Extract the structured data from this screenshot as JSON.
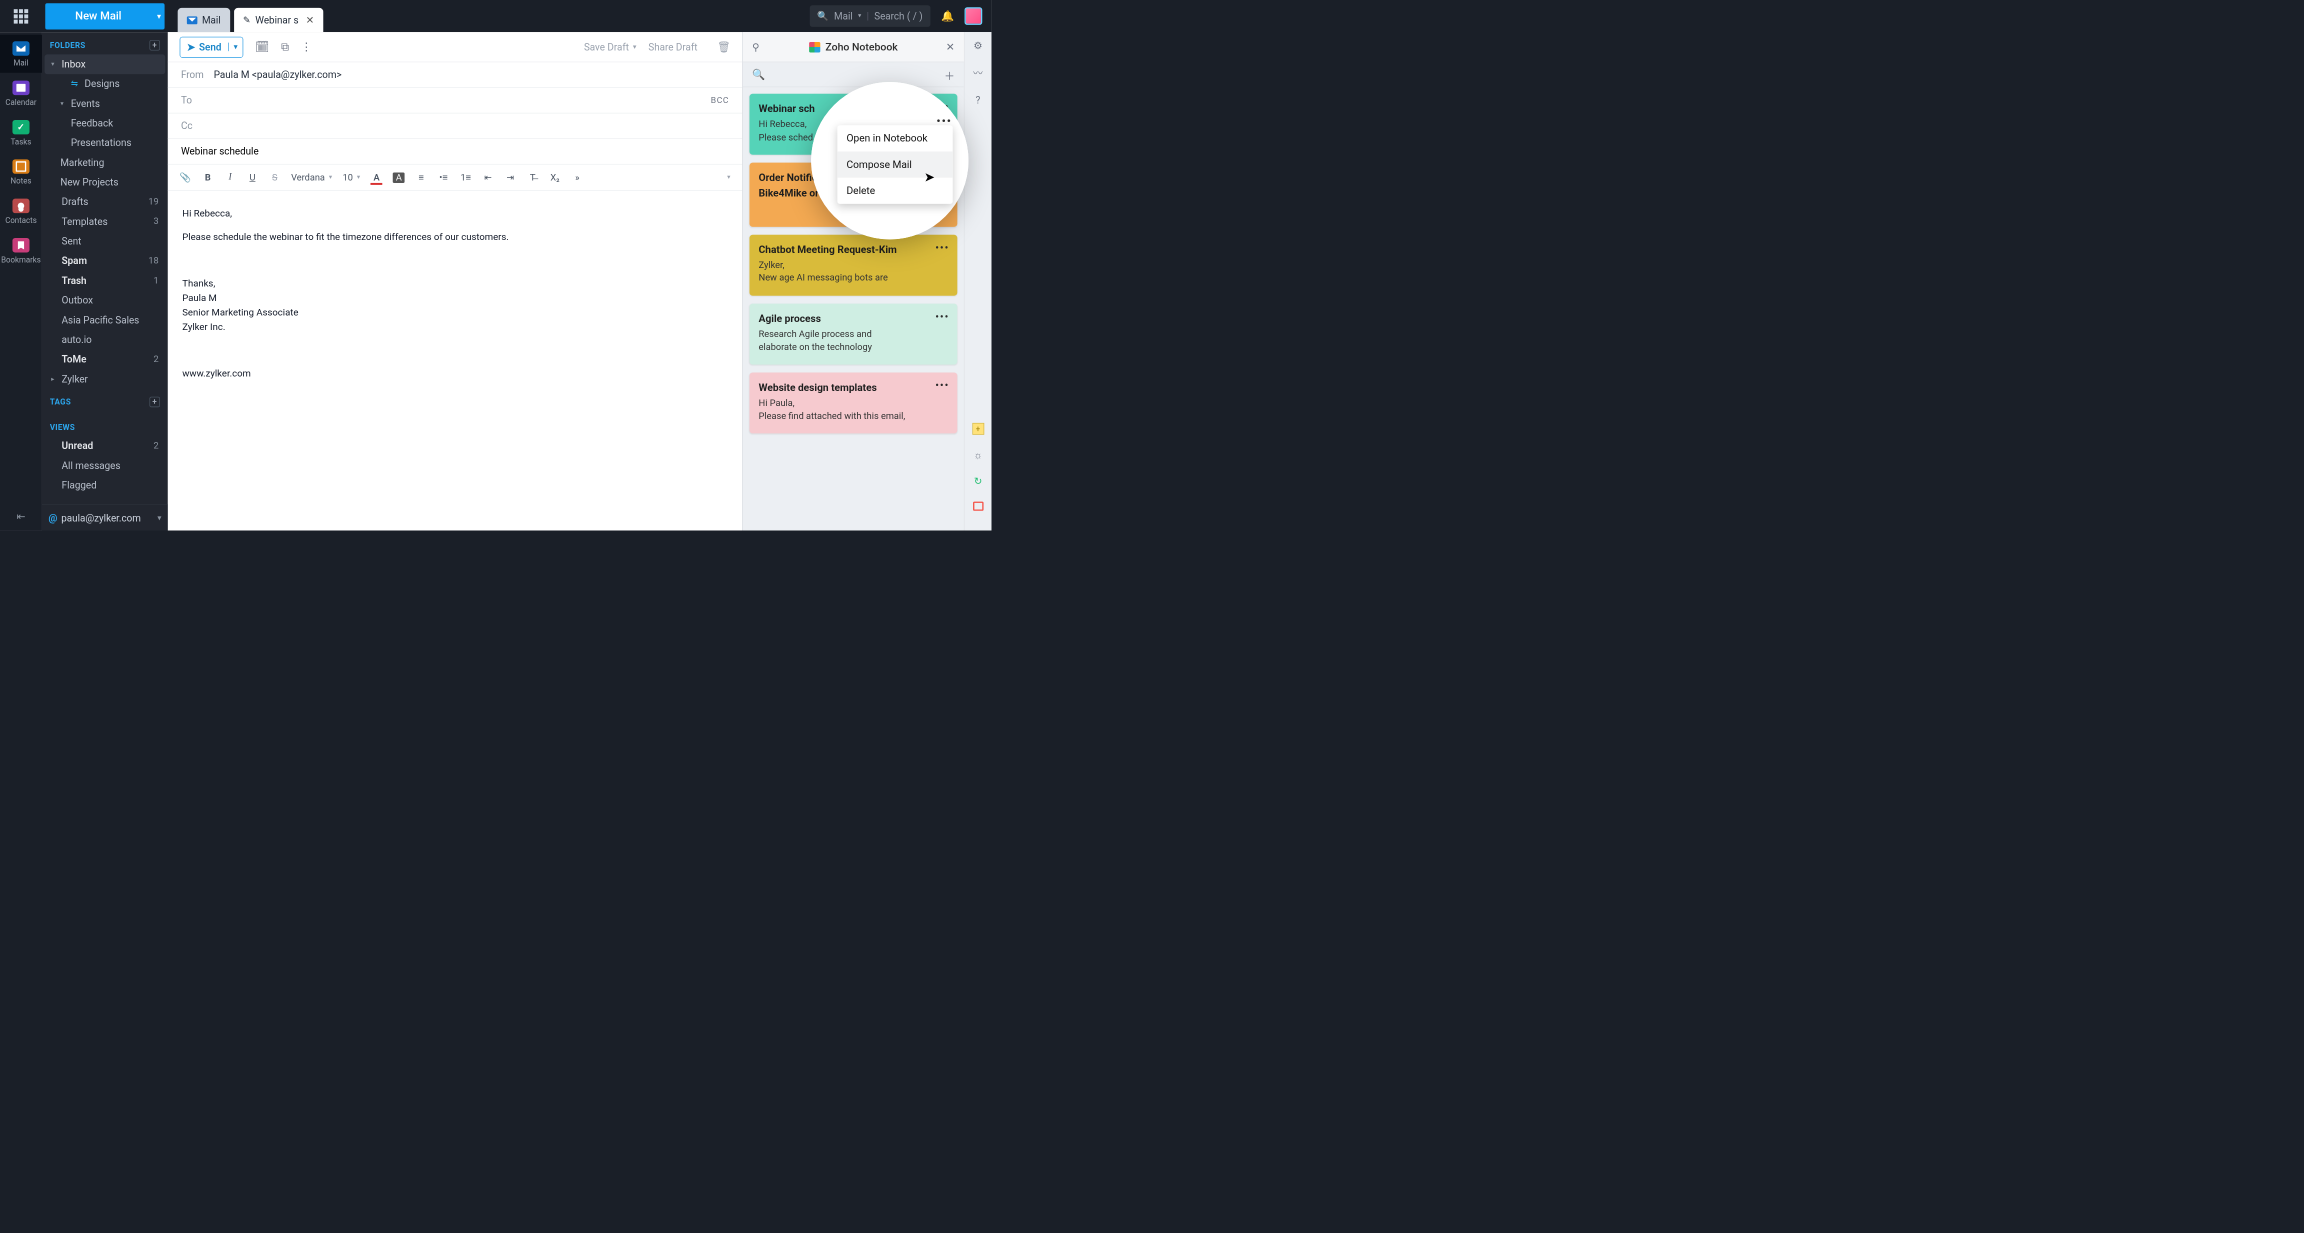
{
  "topbar": {
    "newMail": "New Mail",
    "tabMail": "Mail",
    "tabActive": "Webinar s",
    "searchScope": "Mail",
    "searchPlaceholder": "Search ( / )"
  },
  "rail": {
    "items": [
      "Mail",
      "Calendar",
      "Tasks",
      "Notes",
      "Contacts",
      "Bookmarks"
    ]
  },
  "sidebar": {
    "foldersLabel": "FOLDERS",
    "inbox": "Inbox",
    "designs": "Designs",
    "events": "Events",
    "feedback": "Feedback",
    "presentations": "Presentations",
    "marketing": "Marketing",
    "newProjects": "New Projects",
    "drafts": "Drafts",
    "draftsCount": "19",
    "templates": "Templates",
    "templatesCount": "3",
    "sent": "Sent",
    "spam": "Spam",
    "spamCount": "18",
    "trash": "Trash",
    "trashCount": "1",
    "outbox": "Outbox",
    "asia": "Asia Pacific Sales",
    "auto": "auto.io",
    "tome": "ToMe",
    "tomeCount": "2",
    "zylker": "Zylker",
    "tagsLabel": "TAGS",
    "viewsLabel": "VIEWS",
    "unread": "Unread",
    "unreadCount": "2",
    "allmsg": "All messages",
    "flagged": "Flagged",
    "account": "paula@zylker.com"
  },
  "compose": {
    "send": "Send",
    "saveDraft": "Save Draft",
    "shareDraft": "Share Draft",
    "fromLabel": "From",
    "fromValue": "Paula M <paula@zylker.com>",
    "toLabel": "To",
    "ccLabel": "Cc",
    "bcc": "BCC",
    "subject": "Webinar schedule",
    "font": "Verdana",
    "fontSize": "10",
    "body": {
      "p1": "Hi Rebecca,",
      "p2": "Please schedule the webinar to fit the timezone differences of our customers.",
      "p3": "Thanks,",
      "p4": "Paula M",
      "p5": "Senior Marketing Associate",
      "p6": "Zylker Inc.",
      "p7": "www.zylker.com"
    }
  },
  "notebook": {
    "title": "Zoho Notebook",
    "cards": [
      {
        "title": "Webinar sch",
        "l1": "Hi Rebecca,",
        "l2": "Please sched       e we"
      },
      {
        "title": "Order Notific",
        "l1": "Bike4Mike         or"
      },
      {
        "title": "Chatbot Meeting Request-Kim",
        "l1": "Zylker,",
        "l2": "New age AI messaging bots are"
      },
      {
        "title": "Agile process",
        "l1": "Research Agile process and",
        "l2": "elaborate on the technology"
      },
      {
        "title": "Website design templates",
        "l1": "Hi Paula,",
        "l2": "Please find attached with this email,"
      }
    ],
    "menu": {
      "open": "Open in Notebook",
      "compose": "Compose Mail",
      "delete": "Delete"
    }
  }
}
